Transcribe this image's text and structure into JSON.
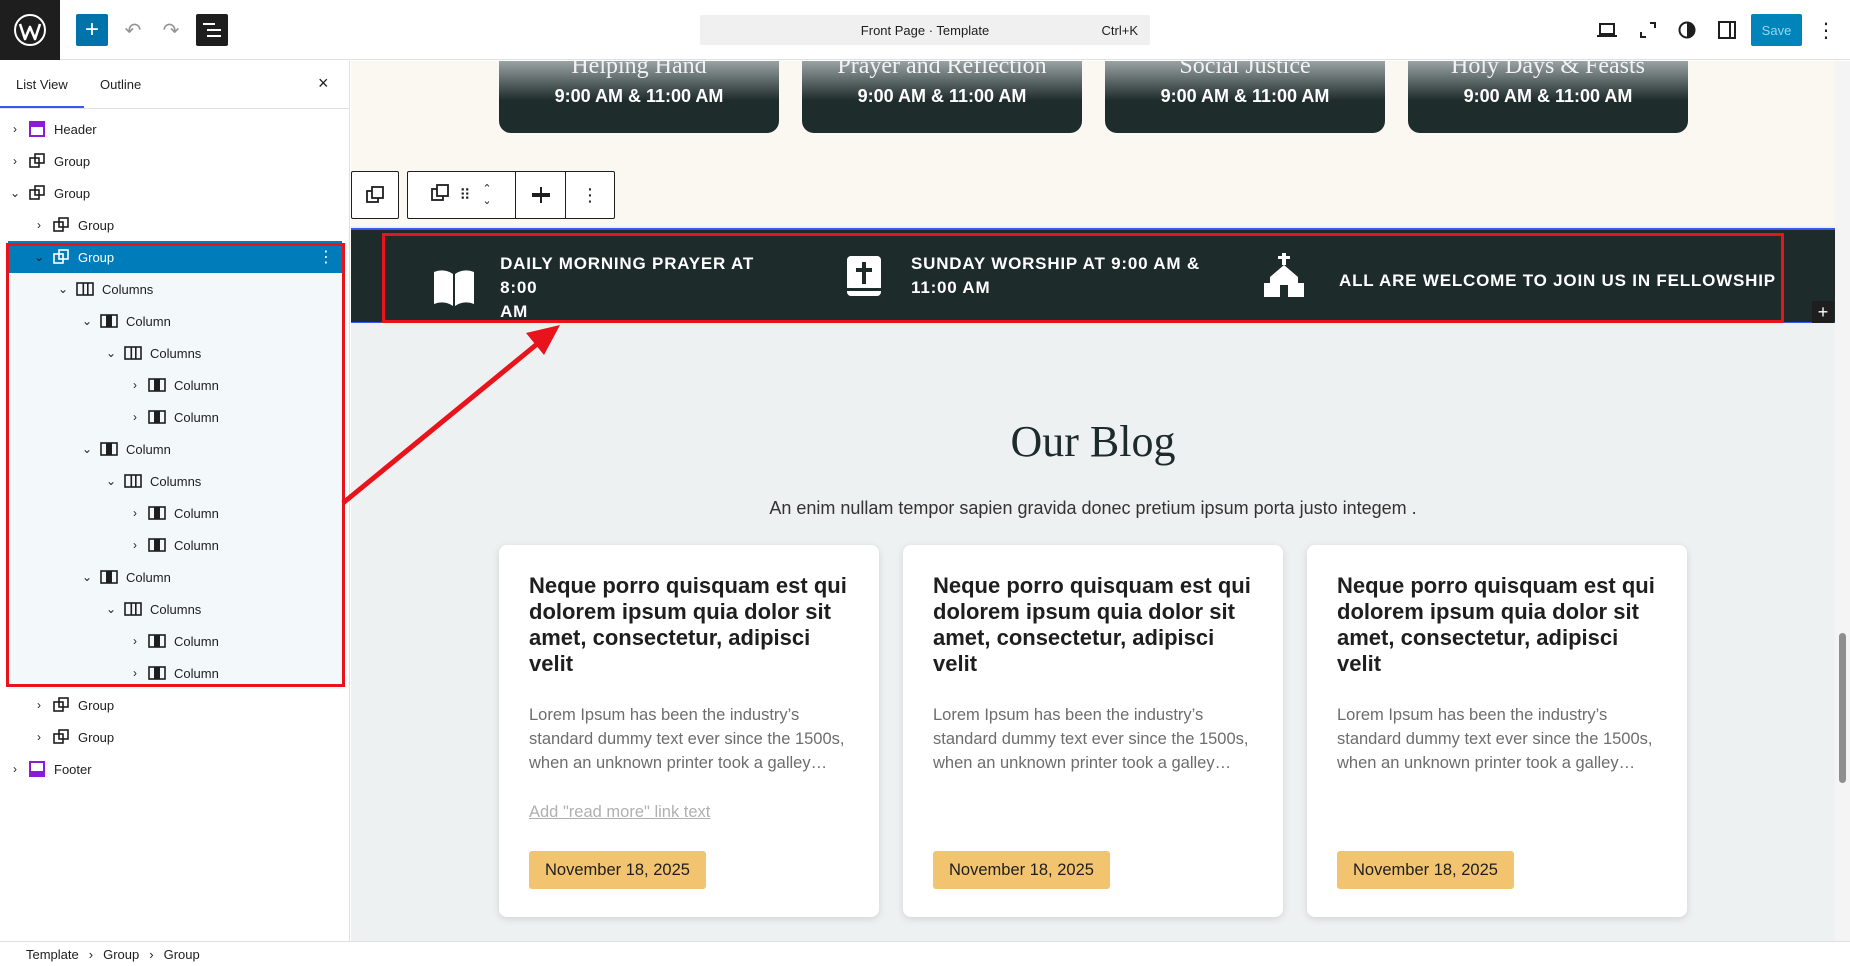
{
  "topbar": {
    "command": "Front Page · Template",
    "shortcut": "Ctrl+K",
    "save_label": "Save"
  },
  "sidebar": {
    "tab_list": "List View",
    "tab_outline": "Outline",
    "close": "×",
    "items": [
      {
        "label": "Header",
        "chev": "›",
        "icon": "header"
      },
      {
        "label": "Group",
        "chev": "›",
        "icon": "group"
      },
      {
        "label": "Group",
        "chev": "⌄",
        "icon": "group"
      },
      {
        "label": "Group",
        "chev": "›",
        "icon": "group"
      },
      {
        "label": "Group",
        "chev": "⌄",
        "icon": "group"
      },
      {
        "label": "Columns",
        "chev": "⌄",
        "icon": "columns"
      },
      {
        "label": "Column",
        "chev": "⌄",
        "icon": "column"
      },
      {
        "label": "Columns",
        "chev": "⌄",
        "icon": "columns"
      },
      {
        "label": "Column",
        "chev": "›",
        "icon": "column"
      },
      {
        "label": "Column",
        "chev": "›",
        "icon": "column"
      },
      {
        "label": "Column",
        "chev": "⌄",
        "icon": "column"
      },
      {
        "label": "Columns",
        "chev": "⌄",
        "icon": "columns"
      },
      {
        "label": "Column",
        "chev": "›",
        "icon": "column"
      },
      {
        "label": "Column",
        "chev": "›",
        "icon": "column"
      },
      {
        "label": "Column",
        "chev": "⌄",
        "icon": "column"
      },
      {
        "label": "Columns",
        "chev": "⌄",
        "icon": "columns"
      },
      {
        "label": "Column",
        "chev": "›",
        "icon": "column"
      },
      {
        "label": "Column",
        "chev": "›",
        "icon": "column"
      },
      {
        "label": "Group",
        "chev": "›",
        "icon": "group"
      },
      {
        "label": "Group",
        "chev": "›",
        "icon": "group"
      },
      {
        "label": "Footer",
        "chev": "›",
        "icon": "footer"
      }
    ]
  },
  "breadcrumb": [
    "Template",
    "›",
    "Group",
    "›",
    "Group"
  ],
  "services": [
    {
      "title": "Helping Hand",
      "time": "9:00 AM & 11:00 AM"
    },
    {
      "title": "Prayer and Reflection",
      "time": "9:00 AM & 11:00 AM"
    },
    {
      "title": "Social Justice",
      "time": "9:00 AM & 11:00 AM"
    },
    {
      "title": "Holy Days & Feasts",
      "time": "9:00 AM & 11:00 AM"
    }
  ],
  "features": [
    {
      "text1": "DAILY MORNING PRAYER AT 8:00",
      "text2": "AM",
      "icon": "open-book-icon"
    },
    {
      "text1": "SUNDAY WORSHIP AT 9:00 AM &",
      "text2": "11:00 AM",
      "icon": "bible-icon"
    },
    {
      "text1": "ALL ARE WELCOME TO JOIN US IN FELLOWSHIP",
      "text2": "",
      "icon": "church-icon"
    }
  ],
  "blog": {
    "title": "Our Blog",
    "subtitle": "An enim nullam tempor sapien gravida donec pretium ipsum porta justo integem .",
    "read_more": "Add \"read more\" link text",
    "posts": [
      {
        "title": "Neque porro quisquam est qui dolorem ipsum quia dolor sit amet, consectetur, adipisci velit",
        "excerpt": "Lorem Ipsum has been the industry’s standard dummy text ever since the 1500s, when an unknown printer took a galley…",
        "date": "November 18, 2025"
      },
      {
        "title": "Neque porro quisquam est qui dolorem ipsum quia dolor sit amet, consectetur, adipisci velit",
        "excerpt": "Lorem Ipsum has been the industry’s standard dummy text ever since the 1500s, when an unknown printer took a galley…",
        "date": "November 18, 2025"
      },
      {
        "title": "Neque porro quisquam est qui dolorem ipsum quia dolor sit amet, consectetur, adipisci velit",
        "excerpt": "Lorem Ipsum has been the industry’s standard dummy text ever since the 1500s, when an unknown printer took a galley…",
        "date": "November 18, 2025"
      }
    ]
  },
  "colors": {
    "accent": "#007cba",
    "annotation": "#e8131b",
    "dark_band": "#1d2b2a",
    "badge": "#f2c46f"
  }
}
